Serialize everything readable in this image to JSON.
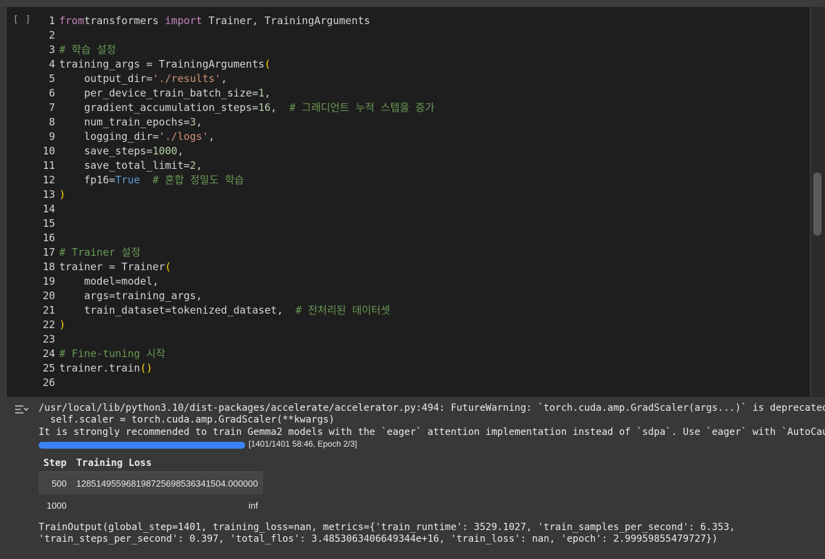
{
  "cell": {
    "run_indicator": "[ ]"
  },
  "code": {
    "lines": [
      {
        "n": "1",
        "segs": [
          [
            "kw",
            "from"
          ],
          [
            "",
            "transformers "
          ],
          [
            "kw",
            "import"
          ],
          [
            "",
            " Trainer, TrainingArguments"
          ]
        ]
      },
      {
        "n": "2",
        "segs": []
      },
      {
        "n": "3",
        "segs": [
          [
            "cm",
            "# 학습 설정"
          ]
        ]
      },
      {
        "n": "4",
        "segs": [
          [
            "",
            "training_args = TrainingArguments"
          ],
          [
            "paren",
            "("
          ]
        ]
      },
      {
        "n": "5",
        "segs": [
          [
            "",
            "    output_dir="
          ],
          [
            "str",
            "'./results'"
          ],
          [
            "",
            ","
          ]
        ]
      },
      {
        "n": "6",
        "segs": [
          [
            "",
            "    per_device_train_batch_size="
          ],
          [
            "num",
            "1"
          ],
          [
            "",
            ","
          ]
        ]
      },
      {
        "n": "7",
        "segs": [
          [
            "",
            "    gradient_accumulation_steps="
          ],
          [
            "num",
            "16"
          ],
          [
            "",
            ",  "
          ],
          [
            "cm",
            "# 그래디언트 누적 스텝을 증가"
          ]
        ]
      },
      {
        "n": "8",
        "segs": [
          [
            "",
            "    num_train_epochs="
          ],
          [
            "num",
            "3"
          ],
          [
            "",
            ","
          ]
        ]
      },
      {
        "n": "9",
        "segs": [
          [
            "",
            "    logging_dir="
          ],
          [
            "str",
            "'./logs'"
          ],
          [
            "",
            ","
          ]
        ]
      },
      {
        "n": "10",
        "segs": [
          [
            "",
            "    save_steps="
          ],
          [
            "num",
            "1000"
          ],
          [
            "",
            ","
          ]
        ]
      },
      {
        "n": "11",
        "segs": [
          [
            "",
            "    save_total_limit="
          ],
          [
            "num",
            "2"
          ],
          [
            "",
            ","
          ]
        ]
      },
      {
        "n": "12",
        "segs": [
          [
            "",
            "    fp16="
          ],
          [
            "bool",
            "True"
          ],
          [
            "",
            "  "
          ],
          [
            "cm",
            "# 혼합 정밀도 학습"
          ]
        ]
      },
      {
        "n": "13",
        "segs": [
          [
            "paren",
            ")"
          ]
        ]
      },
      {
        "n": "14",
        "segs": []
      },
      {
        "n": "15",
        "segs": []
      },
      {
        "n": "16",
        "segs": []
      },
      {
        "n": "17",
        "segs": [
          [
            "cm",
            "# Trainer 설정"
          ]
        ]
      },
      {
        "n": "18",
        "segs": [
          [
            "",
            "trainer = Trainer"
          ],
          [
            "paren",
            "("
          ]
        ]
      },
      {
        "n": "19",
        "segs": [
          [
            "",
            "    model=model,"
          ]
        ]
      },
      {
        "n": "20",
        "segs": [
          [
            "",
            "    args=training_args,"
          ]
        ]
      },
      {
        "n": "21",
        "segs": [
          [
            "",
            "    train_dataset=tokenized_dataset,  "
          ],
          [
            "cm",
            "# 전처리된 데이터셋"
          ]
        ]
      },
      {
        "n": "22",
        "segs": [
          [
            "paren",
            ")"
          ]
        ]
      },
      {
        "n": "23",
        "segs": []
      },
      {
        "n": "24",
        "segs": [
          [
            "cm",
            "# Fine-tuning 시작"
          ]
        ]
      },
      {
        "n": "25",
        "segs": [
          [
            "",
            "trainer.train"
          ],
          [
            "paren",
            "()"
          ]
        ]
      },
      {
        "n": "26",
        "segs": []
      }
    ]
  },
  "output": {
    "warning_line1": "/usr/local/lib/python3.10/dist-packages/accelerate/accelerator.py:494: FutureWarning: `torch.cuda.amp.GradScaler(args...)` is deprecated",
    "warning_line2": "  self.scaler = torch.cuda.amp.GradScaler(**kwargs)",
    "warning_line3": "It is strongly recommended to train Gemma2 models with the `eager` attention implementation instead of `sdpa`. Use `eager` with `AutoCausalLM",
    "progress": {
      "fraction": 1.0,
      "label": "[1401/1401 58:46, Epoch 2/3]"
    },
    "table": {
      "headers": [
        "Step",
        "Training Loss"
      ],
      "rows": [
        [
          "500",
          "128514955968198725698536341504.000000"
        ],
        [
          "1000",
          "inf"
        ]
      ]
    },
    "result_line1": "TrainOutput(global_step=1401, training_loss=nan, metrics={'train_runtime': 3529.1027, 'train_samples_per_second': 6.353,",
    "result_line2": "'train_steps_per_second': 0.397, 'total_flos': 3.4853063406649344e+16, 'train_loss': nan, 'epoch': 2.99959855479727})"
  }
}
